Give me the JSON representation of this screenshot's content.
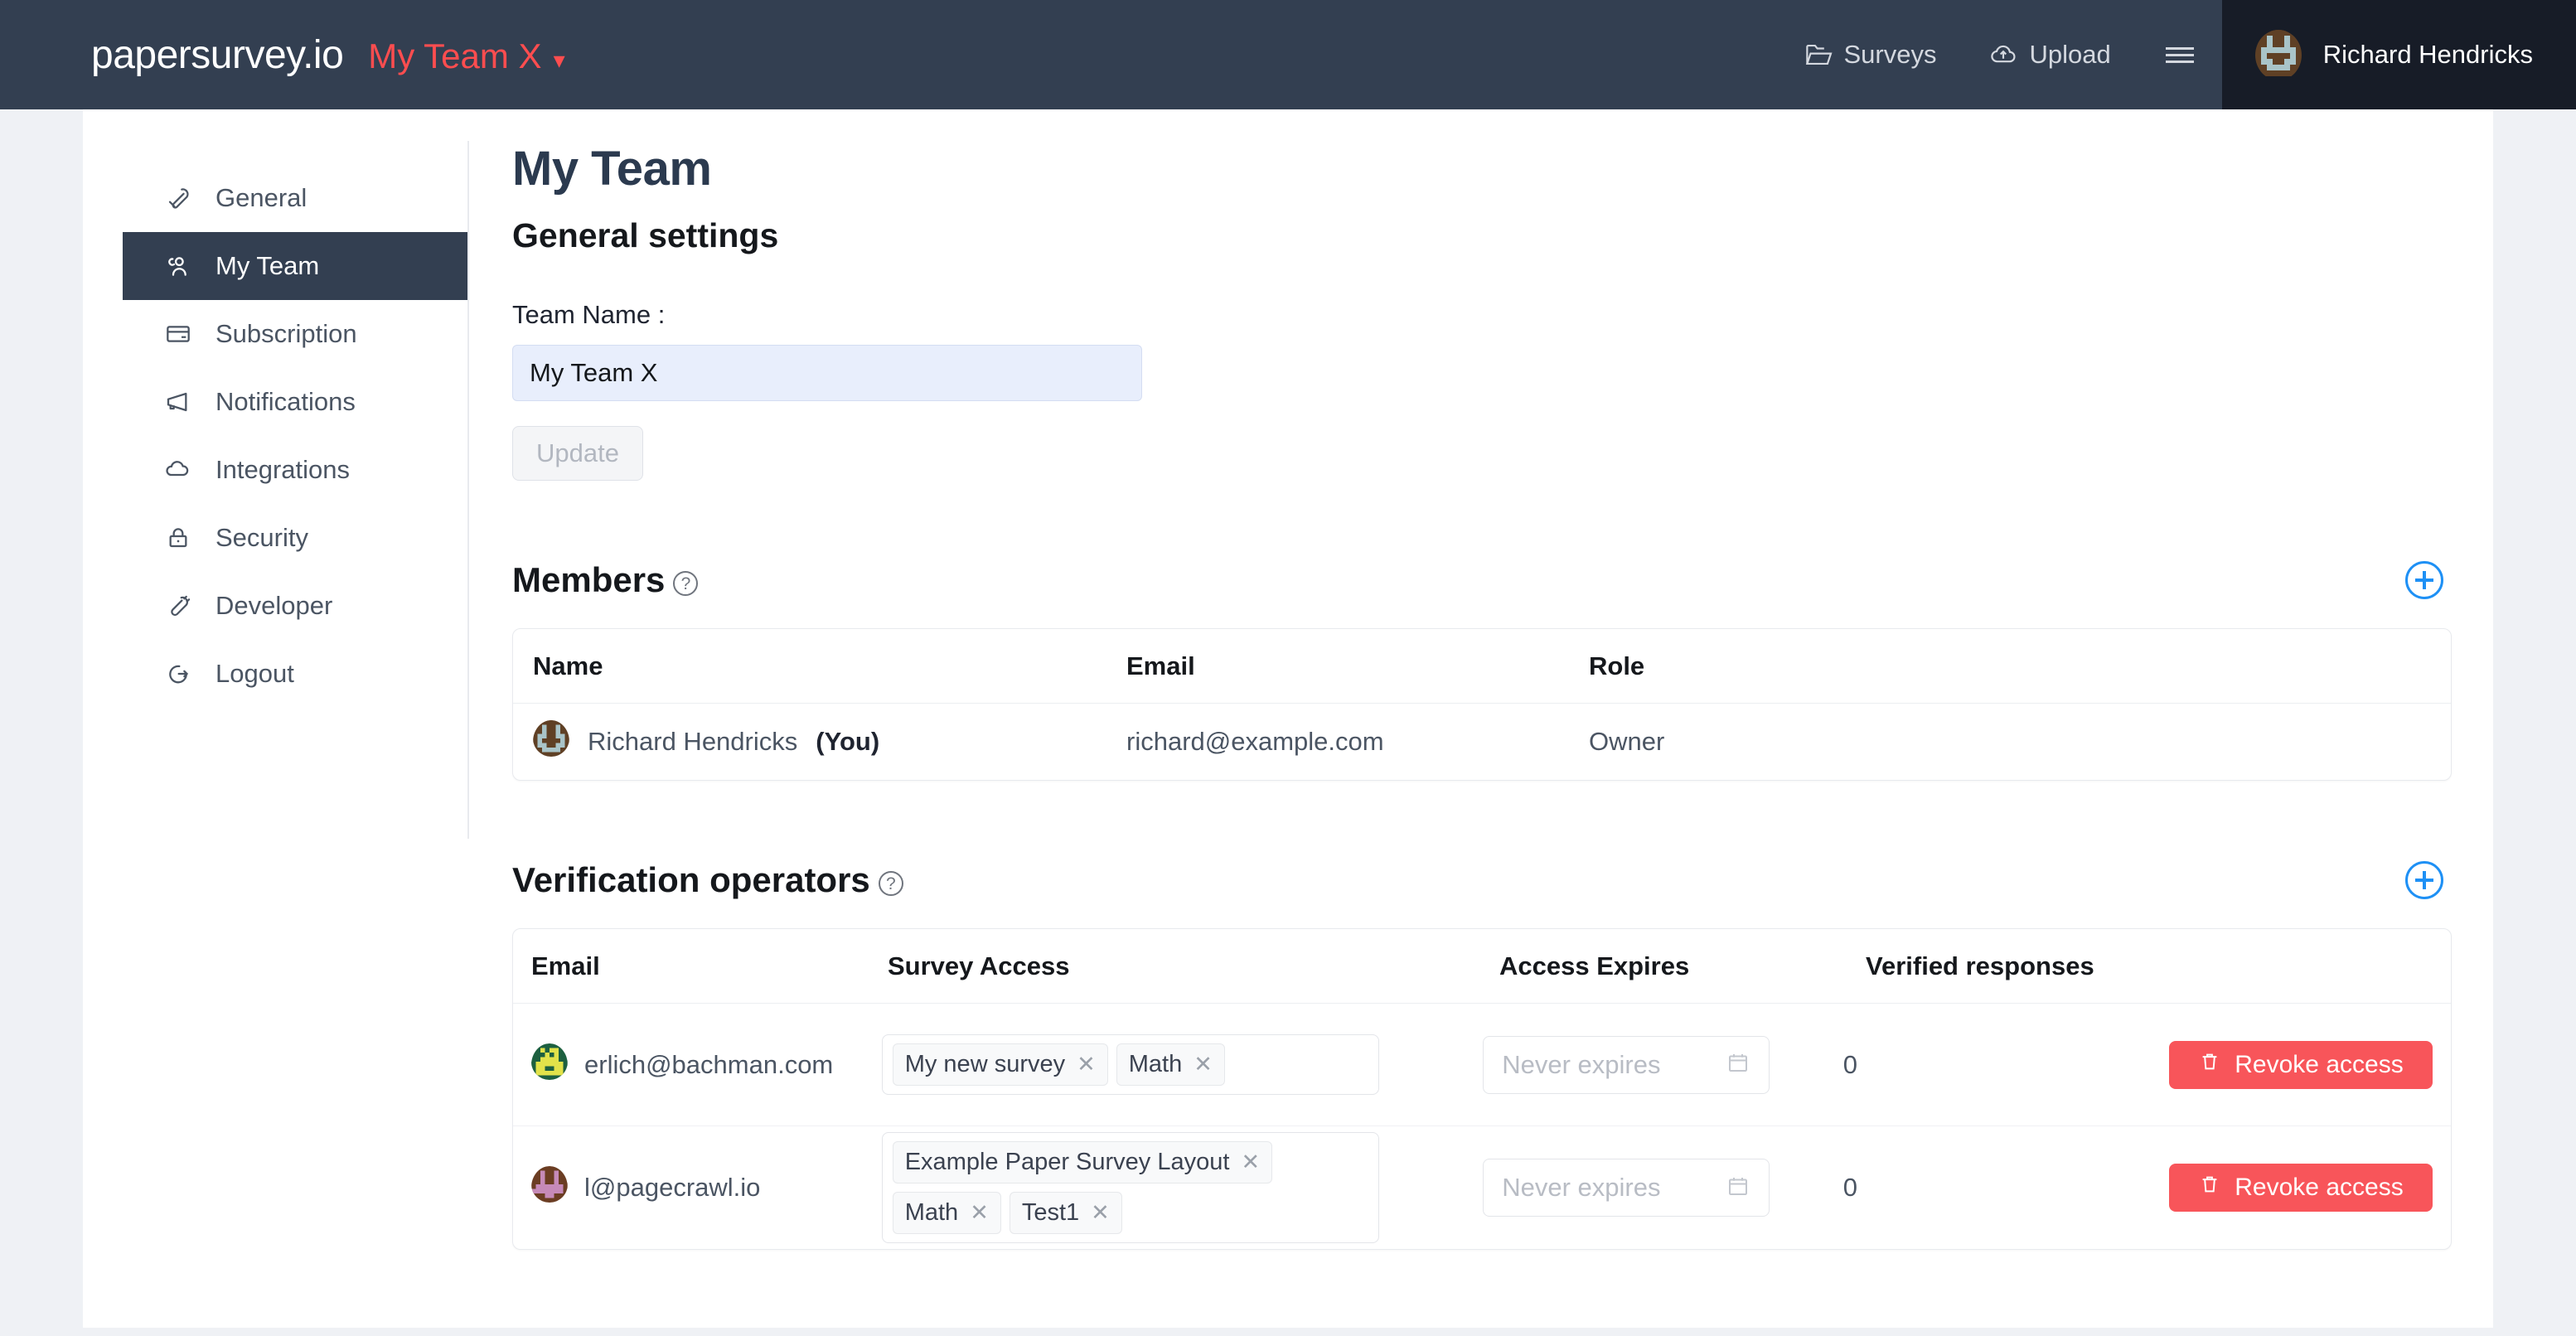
{
  "navbar": {
    "brand": "papersurvey.io",
    "team_switcher": "My Team X",
    "caret": "⌄",
    "links": [
      {
        "label": "Surveys",
        "icon": "folder-icon"
      },
      {
        "label": "Upload",
        "icon": "cloud-upload-icon"
      }
    ],
    "menu_icon": "hamburger-icon",
    "user_name": "Richard Hendricks",
    "colors": {
      "bar": "#333f51",
      "user_chip": "#171c27",
      "team_red": "#ff4d4f"
    }
  },
  "sidebar": {
    "items": [
      {
        "label": "General",
        "icon": "wrench-icon",
        "active": false
      },
      {
        "label": "My Team",
        "icon": "users-icon",
        "active": true
      },
      {
        "label": "Subscription",
        "icon": "credit-card-icon",
        "active": false
      },
      {
        "label": "Notifications",
        "icon": "megaphone-icon",
        "active": false
      },
      {
        "label": "Integrations",
        "icon": "cloud-icon",
        "active": false
      },
      {
        "label": "Security",
        "icon": "lock-icon",
        "active": false
      },
      {
        "label": "Developer",
        "icon": "plug-icon",
        "active": false
      },
      {
        "label": "Logout",
        "icon": "logout-icon",
        "active": false
      }
    ]
  },
  "main": {
    "page_title": "My Team",
    "section_subtitle": "General settings",
    "team_name_label": "Team Name :",
    "team_name_value": "My Team X",
    "update_label": "Update"
  },
  "members": {
    "title": "Members",
    "help_glyph": "?",
    "add_label": "+",
    "columns": [
      "Name",
      "Email",
      "Role"
    ],
    "rows": [
      {
        "name": "Richard Hendricks",
        "you_suffix": "(You)",
        "email": "richard@example.com",
        "role": "Owner",
        "avatar": "identicon-richard"
      }
    ]
  },
  "operators": {
    "title": "Verification operators",
    "help_glyph": "?",
    "add_label": "+",
    "columns": [
      "Email",
      "Survey Access",
      "Access Expires",
      "Verified responses",
      ""
    ],
    "expires_placeholder": "Never expires",
    "revoke_label": "Revoke access",
    "rows": [
      {
        "email": "erlich@bachman.com",
        "avatar": "identicon-erlich",
        "tags": [
          "My new survey",
          "Math"
        ],
        "expires": "",
        "verified_responses": "0"
      },
      {
        "email": "l@pagecrawl.io",
        "avatar": "identicon-pagecrawl",
        "tags": [
          "Example Paper Survey Layout",
          "Math",
          "Test1"
        ],
        "expires": "",
        "verified_responses": "0"
      }
    ],
    "colors": {
      "revoke": "#f8555a",
      "add": "#1e90f5"
    }
  }
}
